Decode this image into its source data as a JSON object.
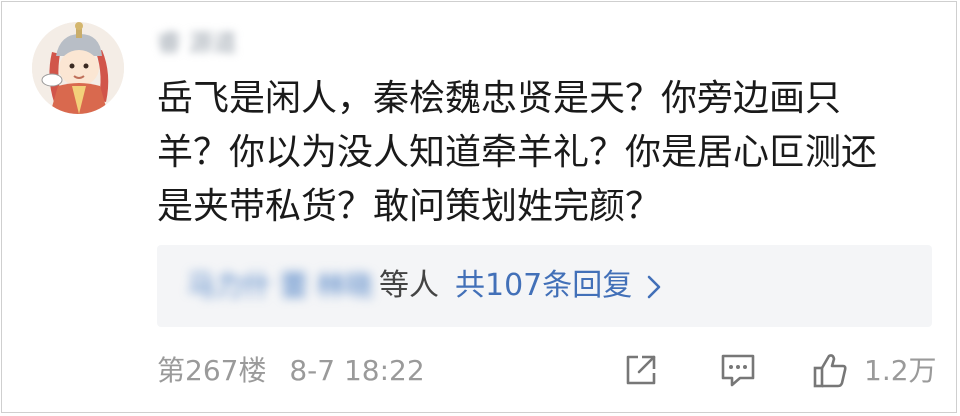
{
  "comment": {
    "username": "睿 源道",
    "content_lines": [
      "岳飞是闲人，秦桧魏忠贤是天？你旁边画只",
      "羊？你以为没人知道牵羊礼？你是居心叵测还",
      "是夹带私货？敢问策划姓完颜？"
    ]
  },
  "replies": {
    "names": "马力什 蕾 林晓",
    "suffix": "等人",
    "count_text": "共107条回复"
  },
  "meta": {
    "floor": "第267楼",
    "time": "8-7 18:22",
    "like_count": "1.2万"
  },
  "icons": {
    "share": "share-icon",
    "comment": "comment-icon",
    "like": "thumbs-up-icon",
    "chevron": "chevron-right-icon"
  },
  "colors": {
    "link": "#4270b8",
    "meta": "#9a9a9a",
    "reply_bg": "#f4f5f7"
  }
}
